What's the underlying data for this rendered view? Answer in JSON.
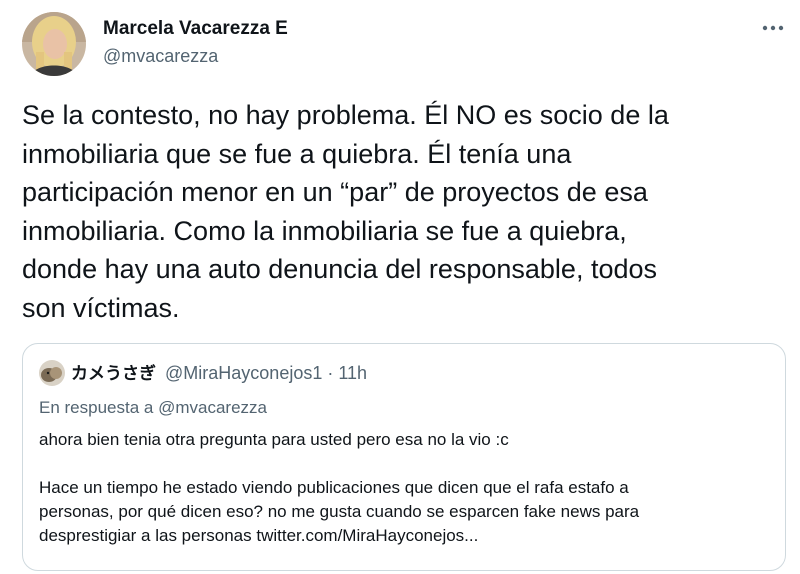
{
  "tweet": {
    "author": {
      "name": "Marcela Vacarezza E",
      "handle": "@mvacarezza"
    },
    "more_icon": "more-horizontal-icon",
    "text_lines": [
      "Se la contesto, no hay problema. Él NO es socio de la",
      "inmobiliaria que se fue a quiebra. Él tenía una",
      "participación menor en un “par” de proyectos de esa",
      "inmobiliaria. Como la inmobiliaria se fue a quiebra,",
      "donde hay una auto denuncia del responsable, todos",
      "son víctimas."
    ]
  },
  "quoted": {
    "name": "カメうさぎ",
    "meta": "@MiraHayconejos1 · 11h",
    "reply_prefix": "En respuesta a",
    "reply_mention": "@mvacarezza",
    "body_line1": "ahora bien tenia otra pregunta para usted pero esa no la vio :c",
    "body_para2": [
      "Hace un tiempo he estado viendo publicaciones que dicen que el rafa estafo a",
      "personas, por qué dicen eso? no me gusta cuando se esparcen fake news para",
      "desprestigiar a las personas  twitter.com/MiraHayconejos..."
    ]
  },
  "colors": {
    "text": "#0f1419",
    "secondary": "#536471",
    "border": "#cfd9de"
  }
}
